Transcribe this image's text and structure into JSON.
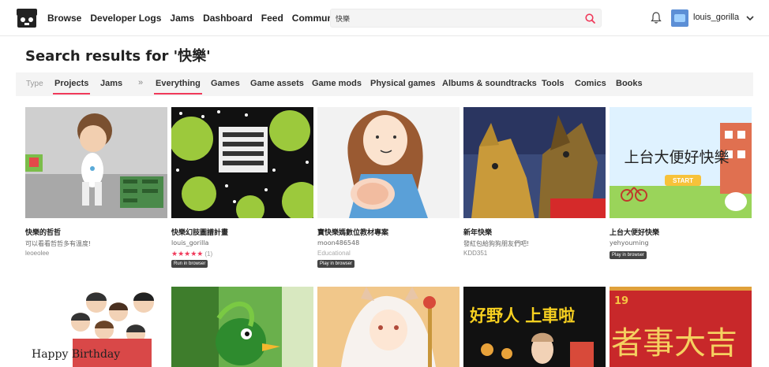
{
  "nav": {
    "items": [
      "Browse",
      "Developer Logs",
      "Jams",
      "Dashboard",
      "Feed",
      "Community"
    ]
  },
  "search": {
    "value": "快樂"
  },
  "user": {
    "name": "louis_gorilla"
  },
  "page_title": "Search results for '快樂'",
  "filters": {
    "type_label": "Type",
    "tabs": [
      "Projects",
      "Jams",
      "»",
      "Everything",
      "Games",
      "Game assets",
      "Game mods",
      "Physical games",
      "Albums & soundtracks",
      "Tools",
      "Comics",
      "Books"
    ],
    "active": [
      "Projects",
      "Everything"
    ]
  },
  "results": [
    {
      "title": "快樂的哲哲",
      "description": "可以看看哲哲多有溫度!",
      "author": "leoeolee"
    },
    {
      "title": "快樂幻肢圖譜計畫",
      "description": "louis_gorilla",
      "stars": "★★★★★",
      "rating_count": "(1)",
      "badge": "Run in browser"
    },
    {
      "title": "寶快樂媽數位教材專案",
      "description": "moon486548",
      "genre": "Educational",
      "badge": "Play in browser"
    },
    {
      "title": "新年快樂",
      "description": "發紅包給狗狗朋友們吧!",
      "author": "KDD351"
    },
    {
      "title": "上台大便好快樂",
      "description": "yehyouming",
      "badge": "Play in browser",
      "thumb_text": "上台大便好快樂",
      "thumb_start": "START"
    }
  ],
  "bottom_thumbs": [
    {
      "text": "Happy Birthday"
    },
    {
      "text": ""
    },
    {
      "text": ""
    },
    {
      "text": "好野人 上車啦"
    },
    {
      "text": "者事大吉",
      "sub": "19"
    }
  ],
  "colors": {
    "accent": "#f0395a",
    "filter_bg": "#f4f4f4",
    "badge_bg": "#444444"
  }
}
